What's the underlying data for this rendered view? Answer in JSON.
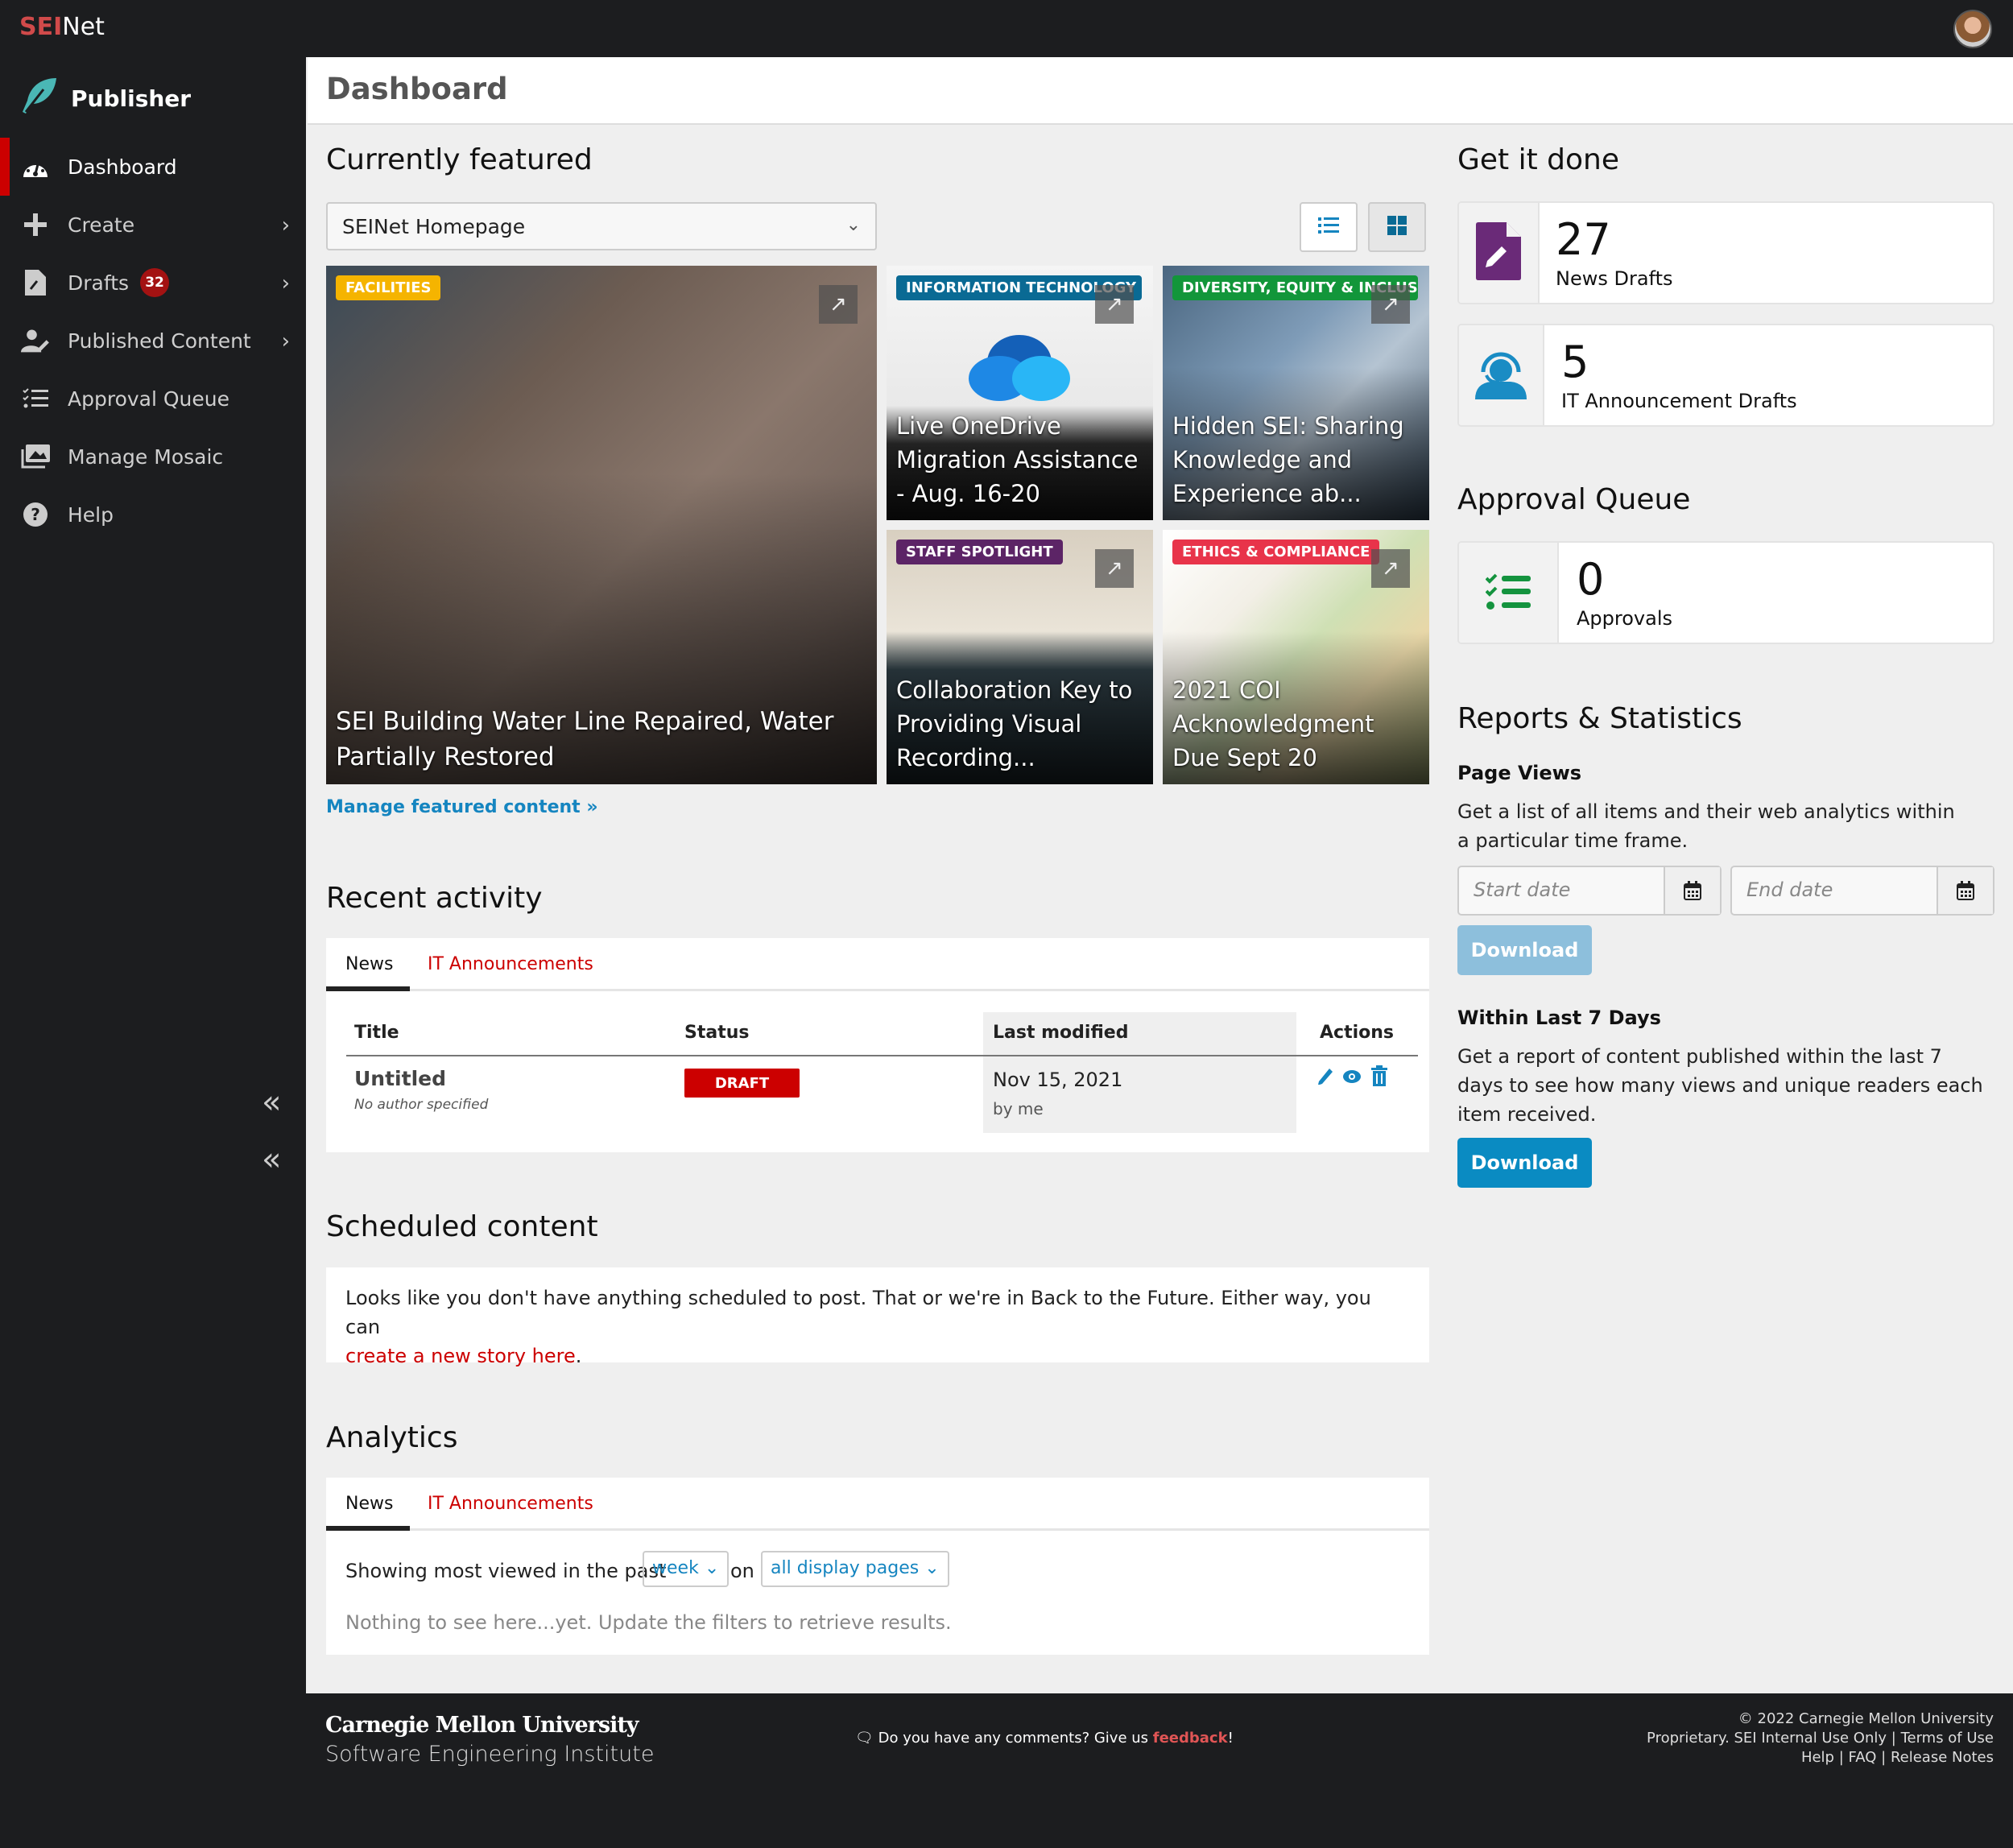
{
  "topbar": {
    "brand_prefix": "SEI",
    "brand_suffix": "Net",
    "avatar_alt": "user-avatar"
  },
  "sidebar": {
    "app_name": "Publisher",
    "items": [
      {
        "label": "Dashboard",
        "icon": "dashboard-gauge-icon",
        "active": true
      },
      {
        "label": "Create",
        "icon": "plus-icon",
        "chevron": true
      },
      {
        "label": "Drafts",
        "icon": "file-pen-icon",
        "badge": "32",
        "chevron": true
      },
      {
        "label": "Published Content",
        "icon": "user-pen-icon",
        "chevron": true
      },
      {
        "label": "Approval Queue",
        "icon": "list-check-icon"
      },
      {
        "label": "Manage Mosaic",
        "icon": "images-icon"
      },
      {
        "label": "Help",
        "icon": "question-circle-icon"
      }
    ],
    "collapse_glyph": "«"
  },
  "page": {
    "title": "Dashboard"
  },
  "featured": {
    "heading": "Currently featured",
    "select_value": "SEINet Homepage",
    "view_list_icon": "list-view-icon",
    "view_grid_icon": "grid-view-icon",
    "cards": [
      {
        "tag": "FACILITIES",
        "tag_color": "#f5b400",
        "title": "SEI Building Water Line Repaired, Water Partially Restored"
      },
      {
        "tag": "INFORMATION TECHNOLOGY",
        "tag_color": "#0a6a94",
        "title": "Live OneDrive Migration Assistance - Aug. 16-20"
      },
      {
        "tag": "DIVERSITY, EQUITY & INCLUSI...",
        "tag_color": "#12963a",
        "title": "Hidden SEI: Sharing Knowledge and Experience ab..."
      },
      {
        "tag": "STAFF SPOTLIGHT",
        "tag_color": "#5c2466",
        "title": "Collaboration Key to Providing Visual Recording..."
      },
      {
        "tag": "ETHICS & COMPLIANCE",
        "tag_color": "#e8344a",
        "title": "2021 COI Acknowledgment Due Sept 20"
      }
    ],
    "manage_link": "Manage featured content",
    "manage_link_glyph": "»"
  },
  "recent_activity": {
    "heading": "Recent activity",
    "tabs": [
      "News",
      "IT Announcements"
    ],
    "columns": [
      "Title",
      "Status",
      "Last modified",
      "Actions"
    ],
    "rows": [
      {
        "title": "Untitled",
        "author": "No author specified",
        "status": "DRAFT",
        "modified_date": "Nov 15, 2021",
        "modified_by": "by me"
      }
    ]
  },
  "scheduled": {
    "heading": "Scheduled content",
    "message": "Looks like you don't have anything scheduled to post. That or we're in Back to the Future. Either way, you can",
    "link": "create a new story here",
    "after": "."
  },
  "analytics": {
    "heading": "Analytics",
    "tabs": [
      "News",
      "IT Announcements"
    ],
    "prefix": "Showing most viewed in the past",
    "period": "week",
    "on": "on",
    "pages": "all display pages",
    "empty": "Nothing to see here...yet. Update the filters to retrieve results."
  },
  "get_it_done": {
    "heading": "Get it done",
    "stats": [
      {
        "value": "27",
        "label": "News Drafts",
        "color": "#6a2a78"
      },
      {
        "value": "5",
        "label": "IT Announcement Drafts",
        "color": "#1a8cc4"
      }
    ]
  },
  "approval_queue": {
    "heading": "Approval Queue",
    "value": "0",
    "label": "Approvals",
    "color": "#14933e"
  },
  "reports": {
    "heading": "Reports & Statistics",
    "page_views_heading": "Page Views",
    "page_views_desc": "Get a list of all items and their web analytics within a particular time frame.",
    "start_placeholder": "Start date",
    "end_placeholder": "End date",
    "download_label": "Download",
    "last7_heading": "Within Last 7 Days",
    "last7_desc": "Get a report of content published within the last 7 days to see how many views and unique readers each item received.",
    "download2_label": "Download"
  },
  "footer": {
    "cmu": "Carnegie Mellon University",
    "sei": "Software Engineering Institute",
    "feedback_prefix": "Do you have any comments? Give us ",
    "feedback_link": "feedback",
    "feedback_suffix": "!",
    "copyright": "© 2022 Carnegie Mellon University",
    "proprietary": "Proprietary. SEI Internal Use Only",
    "terms": "Terms of Use",
    "help": "Help",
    "faq": "FAQ",
    "release_notes": "Release Notes",
    "sep": "|"
  },
  "colors": {
    "accent_red": "#cc0000",
    "link_blue": "#1585c0",
    "dark": "#1c1d1f"
  }
}
